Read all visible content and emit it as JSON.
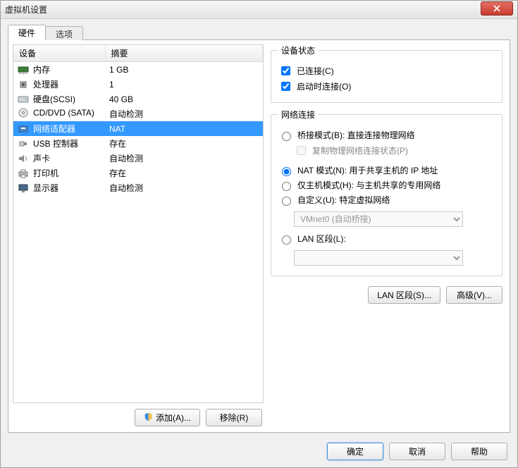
{
  "window": {
    "title": "虚拟机设置"
  },
  "tabs": {
    "hardware": "硬件",
    "options": "选项"
  },
  "table": {
    "headers": {
      "device": "设备",
      "summary": "摘要"
    },
    "rows": [
      {
        "icon": "memory-icon",
        "dev": "内存",
        "sum": "1 GB",
        "sel": false
      },
      {
        "icon": "cpu-icon",
        "dev": "处理器",
        "sum": "1",
        "sel": false
      },
      {
        "icon": "disk-icon",
        "dev": "硬盘(SCSI)",
        "sum": "40 GB",
        "sel": false
      },
      {
        "icon": "cd-icon",
        "dev": "CD/DVD (SATA)",
        "sum": "自动检测",
        "sel": false
      },
      {
        "icon": "nic-icon",
        "dev": "网络适配器",
        "sum": "NAT",
        "sel": true
      },
      {
        "icon": "usb-icon",
        "dev": "USB 控制器",
        "sum": "存在",
        "sel": false
      },
      {
        "icon": "sound-icon",
        "dev": "声卡",
        "sum": "自动检测",
        "sel": false
      },
      {
        "icon": "printer-icon",
        "dev": "打印机",
        "sum": "存在",
        "sel": false
      },
      {
        "icon": "display-icon",
        "dev": "显示器",
        "sum": "自动检测",
        "sel": false
      }
    ]
  },
  "left_buttons": {
    "add": "添加(A)...",
    "remove": "移除(R)"
  },
  "device_state": {
    "legend": "设备状态",
    "connected": {
      "label": "已连接(C)",
      "checked": true
    },
    "connect_at_poweron": {
      "label": "启动时连接(O)",
      "checked": true
    }
  },
  "network": {
    "legend": "网络连接",
    "selected": "nat",
    "bridged": {
      "label": "桥接模式(B): 直接连接物理网络"
    },
    "replicate": {
      "label": "复制物理网络连接状态(P)",
      "checked": false
    },
    "nat": {
      "label": "NAT 模式(N): 用于共享主机的 IP 地址"
    },
    "hostonly": {
      "label": "仅主机模式(H): 与主机共享的专用网络"
    },
    "custom": {
      "label": "自定义(U): 特定虚拟网络"
    },
    "custom_combo": "VMnet0 (自动桥接)",
    "lan_segment": {
      "label": "LAN 区段(L):"
    },
    "lan_combo": ""
  },
  "right_buttons": {
    "lan_segments": "LAN 区段(S)...",
    "advanced": "高级(V)..."
  },
  "footer": {
    "ok": "确定",
    "cancel": "取消",
    "help": "帮助"
  }
}
